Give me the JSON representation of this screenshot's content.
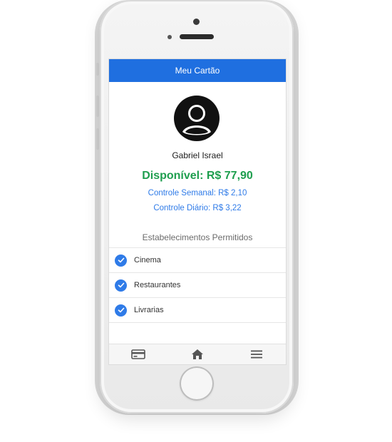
{
  "header": {
    "title": "Meu Cartão"
  },
  "profile": {
    "name": "Gabriel Israel"
  },
  "balance": {
    "available": "Disponível: R$ 77,90",
    "weekly": "Controle Semanal: R$ 2,10",
    "daily": "Controle Diário: R$ 3,22"
  },
  "establishments": {
    "title": "Estabelecimentos Permitidos",
    "items": [
      {
        "label": "Cinema"
      },
      {
        "label": "Restaurantes"
      },
      {
        "label": "Livrarias"
      }
    ]
  },
  "bottom_nav": {
    "items": [
      {
        "icon": "card-icon"
      },
      {
        "icon": "home-icon"
      },
      {
        "icon": "menu-icon"
      }
    ]
  },
  "colors": {
    "header": "#1f6fe0",
    "available": "#1e9e4e",
    "links": "#2f7be8"
  }
}
